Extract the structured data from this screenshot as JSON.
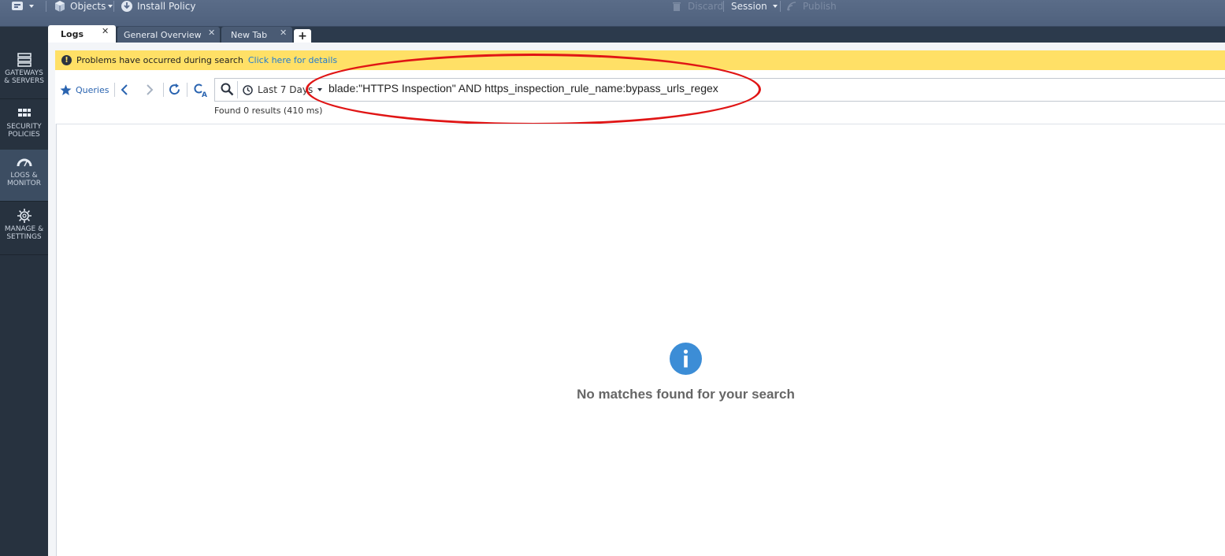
{
  "toolbar": {
    "objects_label": "Objects",
    "install_policy_label": "Install Policy",
    "discard_label": "Discard",
    "session_label": "Session",
    "publish_label": "Publish"
  },
  "sidebar": {
    "items": [
      {
        "label_line1": "GATEWAYS",
        "label_line2": "& SERVERS"
      },
      {
        "label_line1": "SECURITY",
        "label_line2": "POLICIES"
      },
      {
        "label_line1": "LOGS &",
        "label_line2": "MONITOR"
      },
      {
        "label_line1": "MANAGE &",
        "label_line2": "SETTINGS"
      }
    ]
  },
  "tabs": [
    {
      "label": "Logs",
      "active": true
    },
    {
      "label": "General Overview",
      "active": false
    },
    {
      "label": "New Tab",
      "active": false
    }
  ],
  "warning": {
    "message": "Problems have occurred during search",
    "link": "Click here for details"
  },
  "query": {
    "queries_label": "Queries",
    "time_range": "Last 7 Days",
    "search_text": "blade:\"HTTPS Inspection\"  AND https_inspection_rule_name:bypass_urls_regex",
    "results": "Found 0 results (410 ms)"
  },
  "empty_state": {
    "message": "No matches found for your search"
  },
  "colors": {
    "toolbar_bg": "#56688a",
    "sidebar_bg": "#27323f",
    "sidebar_active": "#3c4d62",
    "warning_bg": "#ffe066",
    "link": "#1f7ad1",
    "info_icon": "#3c8dd6",
    "annotation": "#e01515"
  }
}
